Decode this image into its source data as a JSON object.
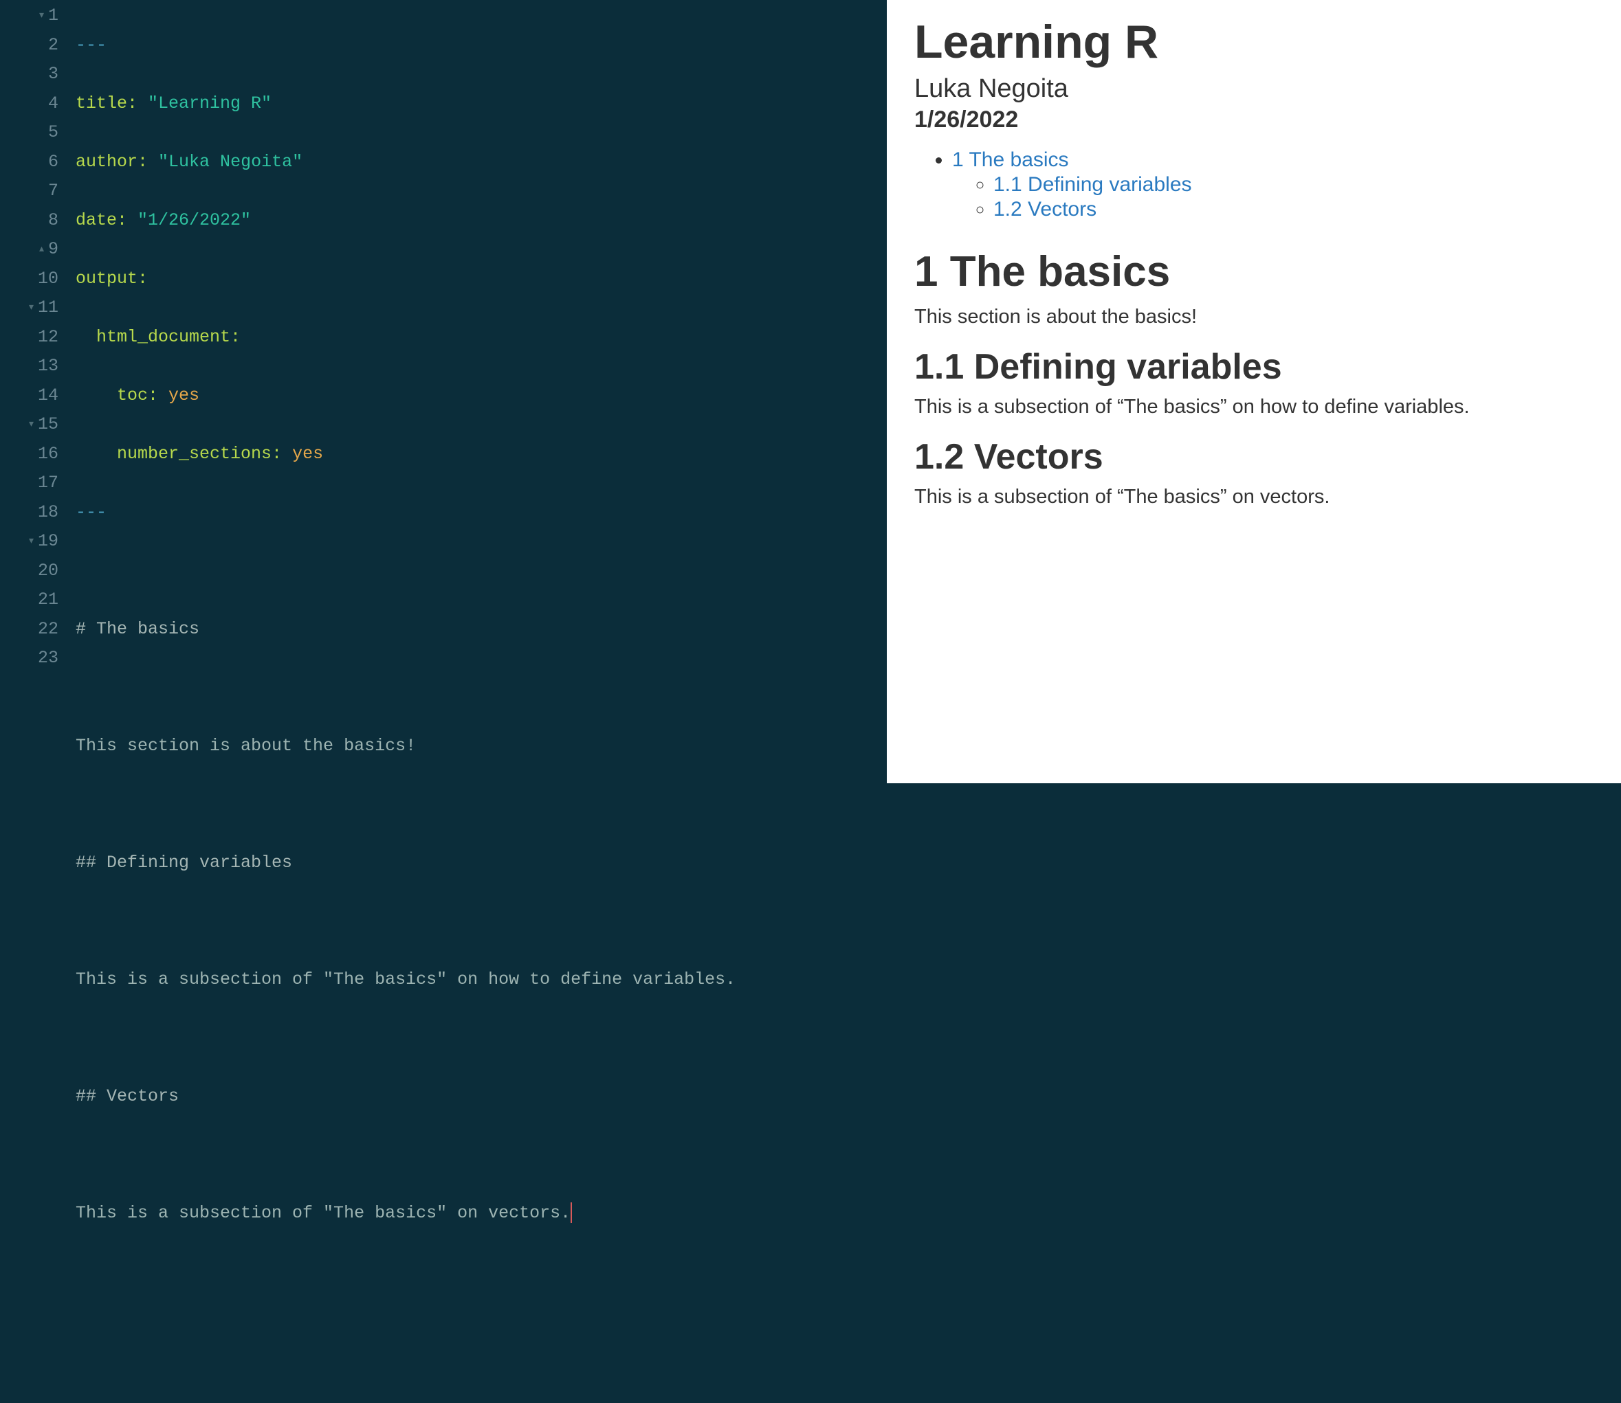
{
  "editor": {
    "lines": {
      "l1_dashes": "---",
      "l2_key": "title:",
      "l2_val": "\"Learning R\"",
      "l3_key": "author:",
      "l3_val": "\"Luka Negoita\"",
      "l4_key": "date:",
      "l4_val": "\"1/26/2022\"",
      "l5_key": "output:",
      "l6_key": "html_document:",
      "l7_key": "toc:",
      "l7_val": "yes",
      "l8_key": "number_sections:",
      "l8_val": "yes",
      "l9_dashes": "---",
      "l11": "# The basics",
      "l13": "This section is about the basics!",
      "l15": "## Defining variables",
      "l17": "This is a subsection of \"The basics\" on how to define variables.",
      "l19": "## Vectors",
      "l21": "This is a subsection of \"The basics\" on vectors."
    },
    "line_numbers": [
      "1",
      "2",
      "3",
      "4",
      "5",
      "6",
      "7",
      "8",
      "9",
      "10",
      "11",
      "12",
      "13",
      "14",
      "15",
      "16",
      "17",
      "18",
      "19",
      "20",
      "21",
      "22",
      "23"
    ]
  },
  "preview": {
    "title": "Learning R",
    "author": "Luka Negoita",
    "date": "1/26/2022",
    "toc": {
      "item1": "1 The basics",
      "item1_1": "1.1 Defining variables",
      "item1_2": "1.2 Vectors"
    },
    "sections": {
      "s1_title": "1 The basics",
      "s1_body": "This section is about the basics!",
      "s1_1_title": "1.1 Defining variables",
      "s1_1_body": "This is a subsection of “The basics” on how to define variables.",
      "s1_2_title": "1.2 Vectors",
      "s1_2_body": "This is a subsection of “The basics” on vectors."
    }
  }
}
